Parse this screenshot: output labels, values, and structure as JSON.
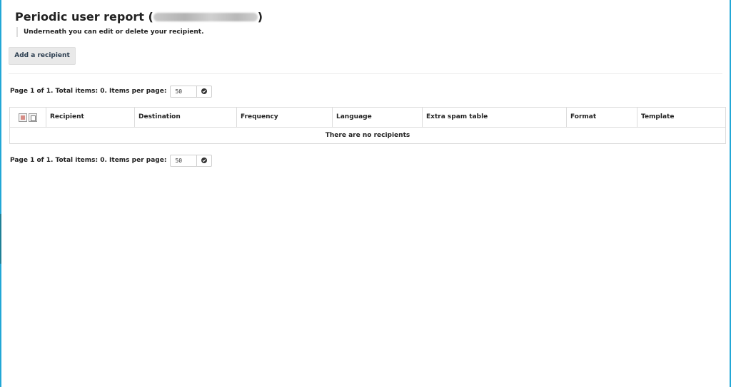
{
  "header": {
    "title_prefix": "Periodic user report (",
    "title_suffix": ")",
    "subtitle": "Underneath you can edit or delete your recipient."
  },
  "toolbar": {
    "add_label": "Add a recipient"
  },
  "pager": {
    "text": "Page 1 of 1. Total items: 0. Items per page:",
    "per_page_value": "50"
  },
  "table": {
    "columns": [
      "Recipient",
      "Destination",
      "Frequency",
      "Language",
      "Extra spam table",
      "Format",
      "Template"
    ],
    "empty_message": "There are no recipients"
  },
  "icons": {
    "per_page_apply": "check-circle-icon",
    "delete_selected": "delete-selected-icon",
    "select_all": "copy-icon"
  },
  "colors": {
    "frame_accent": "#22a7d6",
    "button_bg": "#e9e9e9",
    "button_text": "#2c3e50"
  }
}
